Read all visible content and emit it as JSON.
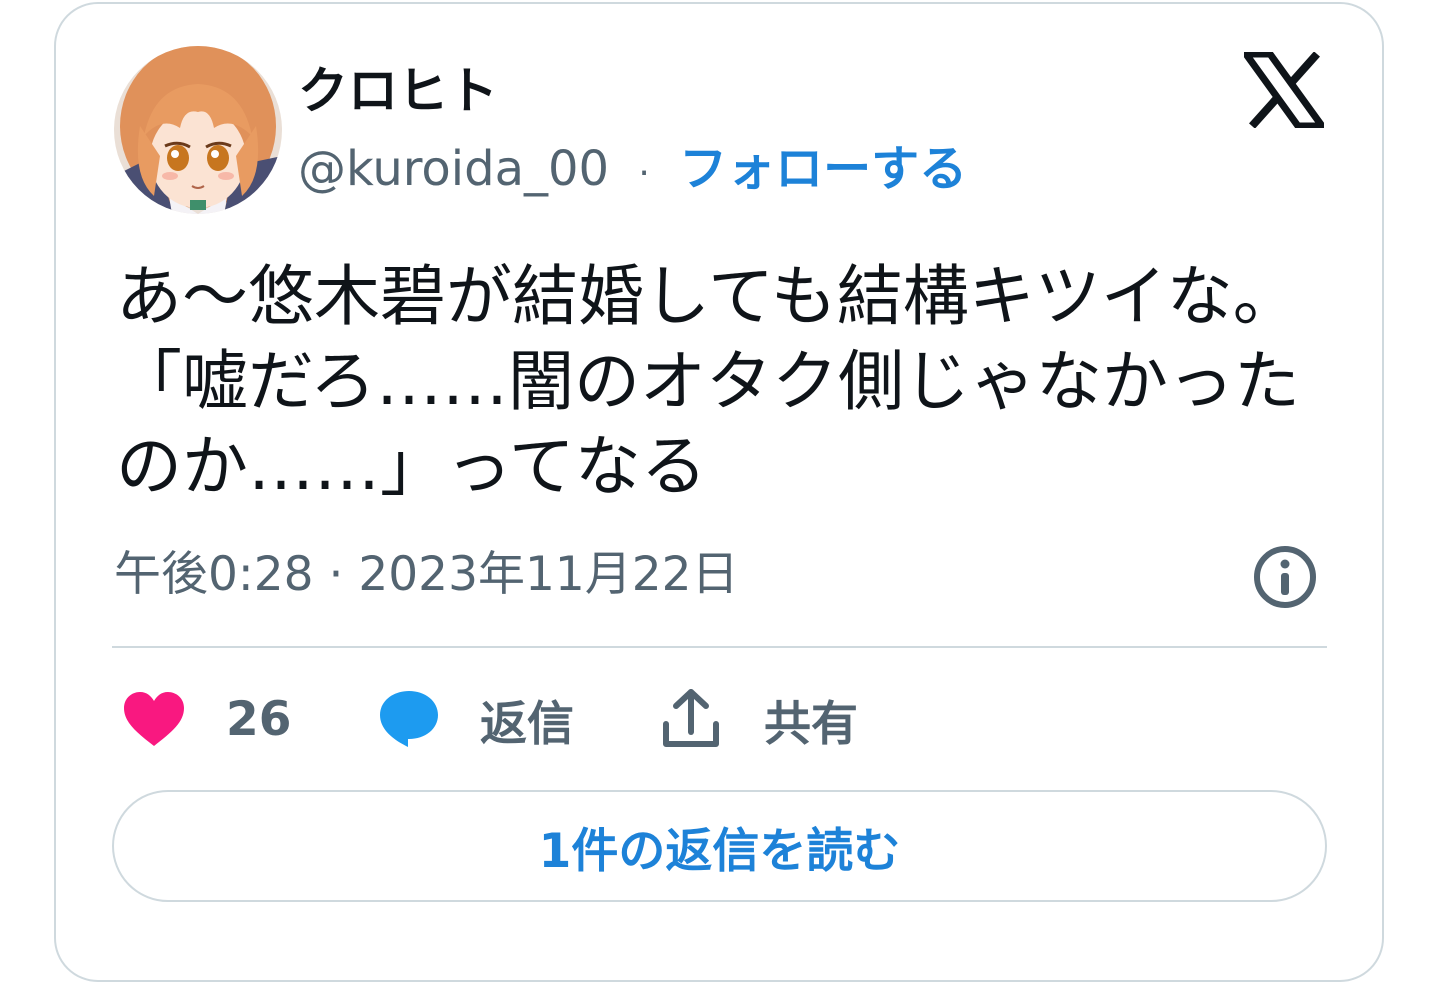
{
  "user": {
    "display_name": "クロヒト",
    "handle": "@kuroida_00",
    "separator": "·",
    "follow_label": "フォローする"
  },
  "tweet": {
    "text": "あ〜悠木碧が結婚しても結構キツイな。「嘘だろ……闇のオタク側じゃなかったのか……」ってなる",
    "timestamp": "午後0:28 · 2023年11月22日"
  },
  "actions": {
    "like_count": "26",
    "reply_label": "返信",
    "share_label": "共有"
  },
  "read_replies_label": "1件の返信を読む",
  "icons": {
    "x_logo": "x-logo-icon",
    "info": "info-icon",
    "like": "heart-icon",
    "reply": "speech-bubble-icon",
    "share": "share-upload-icon"
  },
  "colors": {
    "accent": "#1d82d8",
    "like": "#f91880",
    "reply": "#1d9bf0",
    "secondary_text": "#536471",
    "primary_text": "#0f1419",
    "border": "#cfd9de"
  }
}
